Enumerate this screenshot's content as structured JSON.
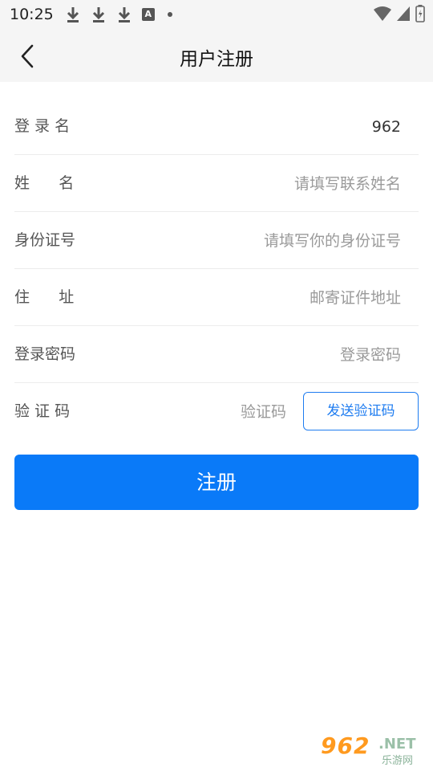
{
  "status_bar": {
    "time": "10:25",
    "notification_icons": [
      "download-icon",
      "download-icon",
      "download-icon",
      "a-badge-icon",
      "dot-icon"
    ],
    "system_icons": [
      "wifi-icon",
      "cell-signal-icon",
      "battery-icon"
    ],
    "a_badge_text": "A"
  },
  "header": {
    "title": "用户注册",
    "back_icon": "chevron-left-icon"
  },
  "form": {
    "login_name": {
      "label": "登 录 名",
      "value": "962",
      "placeholder": ""
    },
    "name": {
      "label": "姓      名",
      "value": "",
      "placeholder": "请填写联系姓名"
    },
    "id_number": {
      "label": "身份证号",
      "value": "",
      "placeholder": "请填写你的身份证号"
    },
    "address": {
      "label": "住      址",
      "value": "",
      "placeholder": "邮寄证件地址"
    },
    "password": {
      "label": "登录密码",
      "value": "",
      "placeholder": "登录密码"
    },
    "verify_code": {
      "label": "验 证 码",
      "value": "",
      "placeholder": "验证码",
      "send_label": "发送验证码"
    }
  },
  "register_button": {
    "label": "注册"
  },
  "watermark": {
    "big": "962",
    "net": ".NET",
    "sub": "乐游网"
  },
  "colors": {
    "accent": "#0a7af8",
    "outline_blue": "#1e7cf0",
    "header_bg": "#f5f5f5"
  }
}
